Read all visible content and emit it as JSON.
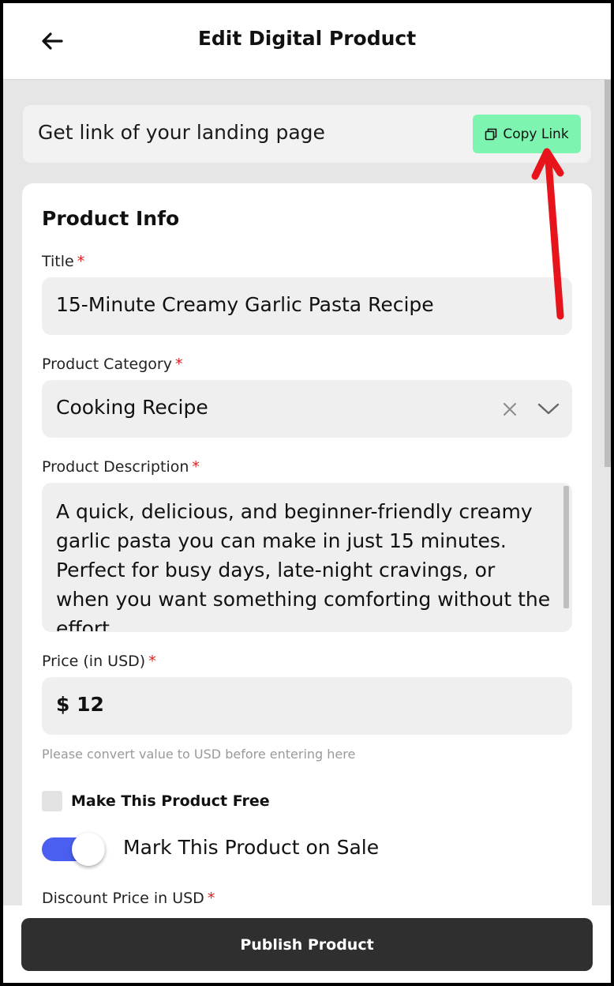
{
  "header": {
    "title": "Edit Digital Product",
    "back_icon": "arrow-left-icon"
  },
  "link_card": {
    "text": "Get link of your landing page",
    "copy_button_label": "Copy Link",
    "copy_icon": "copy-icon",
    "button_color": "#7df5b0"
  },
  "form": {
    "section_title": "Product Info",
    "required_marker": "*",
    "title_label": "Title",
    "title_value": "15-Minute Creamy Garlic Pasta Recipe",
    "category_label": "Product Category",
    "category_value": "Cooking Recipe",
    "description_label": "Product Description",
    "description_value": "A quick, delicious, and beginner-friendly creamy garlic pasta you can make in just 15 minutes. Perfect for busy days, late-night cravings, or when you want something comforting without the effort.",
    "price_label": "Price (in USD)",
    "price_value": "$ 12",
    "price_hint": "Please convert value to USD before entering here",
    "free_label": "Make This Product Free",
    "free_checked": false,
    "sale_label": "Mark This Product on Sale",
    "sale_enabled": true,
    "discount_label": "Discount Price in USD",
    "toggle_color": "#4a5ef0",
    "required_color": "#e11d1d"
  },
  "footer": {
    "publish_label": "Publish Product"
  },
  "annotation": {
    "type": "red-arrow",
    "color": "#e8141c",
    "points_to": "copy-link-button"
  }
}
